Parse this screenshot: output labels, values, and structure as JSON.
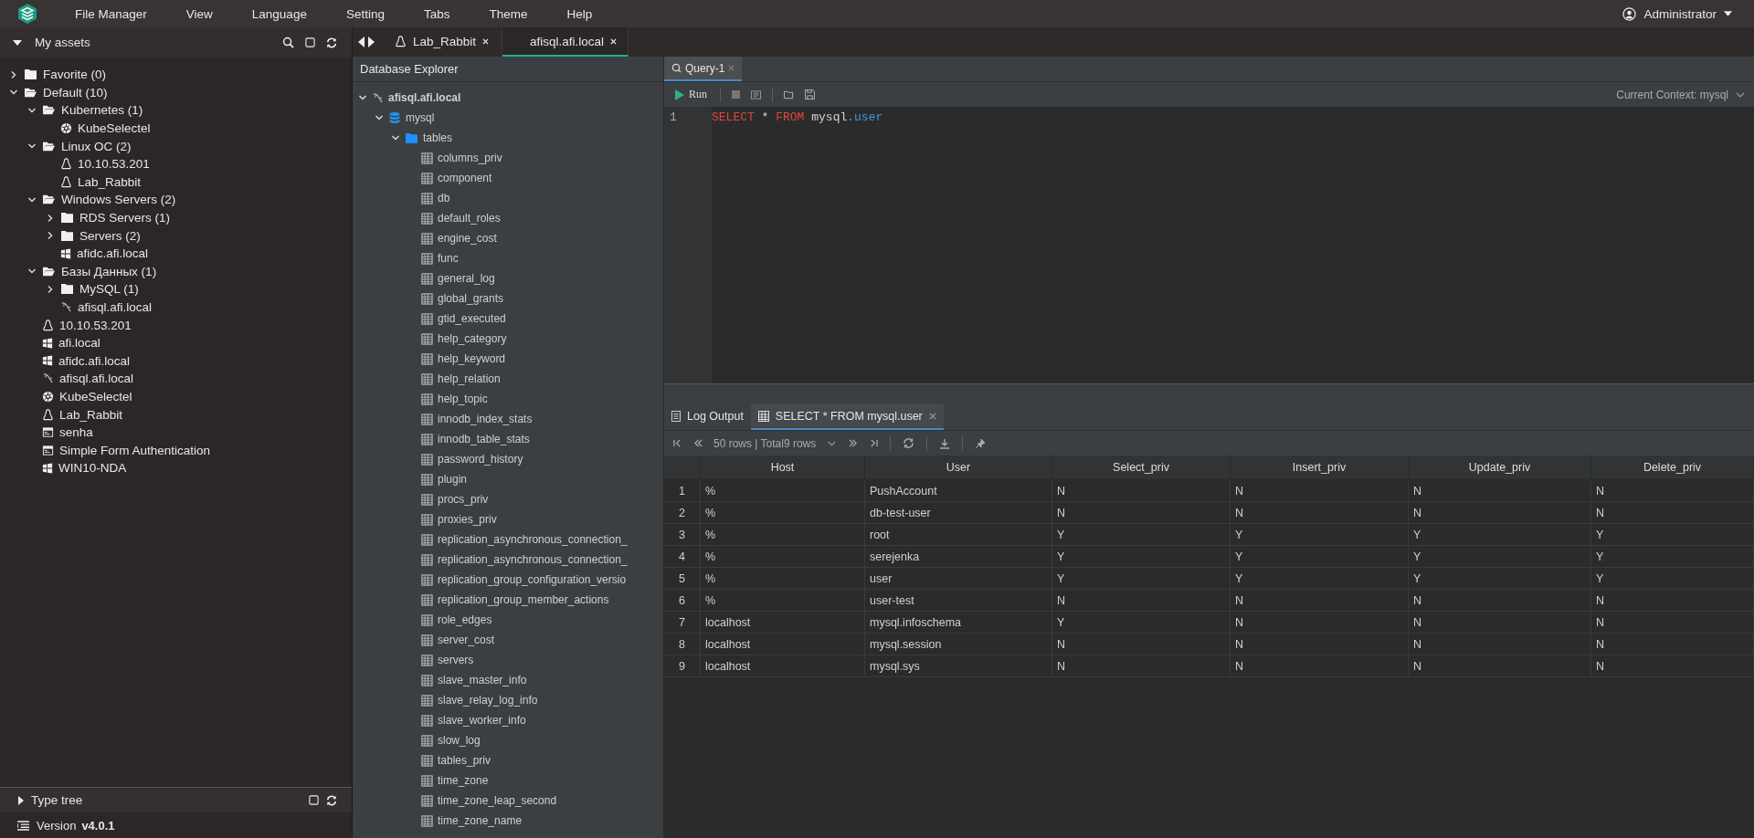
{
  "menu_bar": {
    "items": [
      "File Manager",
      "View",
      "Language",
      "Setting",
      "Tabs",
      "Theme",
      "Help"
    ],
    "user": "Administrator"
  },
  "assets": {
    "title": "My assets",
    "tree": [
      {
        "label": "Favorite (0)",
        "kind": "folder",
        "expanded": false
      },
      {
        "label": "Default (10)",
        "kind": "folder",
        "expanded": true,
        "children": [
          {
            "label": "Kubernetes (1)",
            "kind": "folder",
            "expanded": true,
            "children": [
              {
                "label": "KubeSelectel",
                "kind": "k8s"
              }
            ]
          },
          {
            "label": "Linux OC (2)",
            "kind": "folder",
            "expanded": true,
            "children": [
              {
                "label": "10.10.53.201",
                "kind": "linux"
              },
              {
                "label": "Lab_Rabbit",
                "kind": "linux"
              }
            ]
          },
          {
            "label": "Windows Servers (2)",
            "kind": "folder",
            "expanded": true,
            "children": [
              {
                "label": "RDS Servers (1)",
                "kind": "folder",
                "expanded": false
              },
              {
                "label": "Servers (2)",
                "kind": "folder",
                "expanded": false
              },
              {
                "label": "afidc.afi.local",
                "kind": "windows"
              }
            ]
          },
          {
            "label": "Базы Данных (1)",
            "kind": "folder",
            "expanded": true,
            "children": [
              {
                "label": "MySQL (1)",
                "kind": "folder",
                "expanded": false
              },
              {
                "label": "afisql.afi.local",
                "kind": "mysql"
              }
            ]
          },
          {
            "label": "10.10.53.201",
            "kind": "linux"
          },
          {
            "label": "afi.local",
            "kind": "windows"
          },
          {
            "label": "afidc.afi.local",
            "kind": "windows"
          },
          {
            "label": "afisql.afi.local",
            "kind": "mysql"
          },
          {
            "label": "KubeSelectel",
            "kind": "k8s"
          },
          {
            "label": "Lab_Rabbit",
            "kind": "linux"
          },
          {
            "label": "senha",
            "kind": "web"
          },
          {
            "label": "Simple Form Authentication",
            "kind": "web"
          },
          {
            "label": "WIN10-NDA",
            "kind": "windows"
          }
        ]
      }
    ]
  },
  "type_tree": {
    "label": "Type tree",
    "expanded": false
  },
  "version": {
    "label": "Version",
    "value": "v4.0.1"
  },
  "session_tabs": [
    {
      "label": "Lab_Rabbit",
      "kind": "linux",
      "selected": false
    },
    {
      "label": "afisql.afi.local",
      "kind": "plain",
      "selected": true
    }
  ],
  "explorer": {
    "title": "Database Explorer",
    "tree": [
      {
        "label": "afisql.afi.local",
        "kind": "mysql",
        "expanded": true,
        "children": [
          {
            "label": "mysql",
            "kind": "database",
            "expanded": true,
            "children": [
              {
                "label": "tables",
                "kind": "dbfolder",
                "expanded": true,
                "children": [
                  {
                    "label": "columns_priv",
                    "kind": "table"
                  },
                  {
                    "label": "component",
                    "kind": "table"
                  },
                  {
                    "label": "db",
                    "kind": "table"
                  },
                  {
                    "label": "default_roles",
                    "kind": "table"
                  },
                  {
                    "label": "engine_cost",
                    "kind": "table"
                  },
                  {
                    "label": "func",
                    "kind": "table"
                  },
                  {
                    "label": "general_log",
                    "kind": "table"
                  },
                  {
                    "label": "global_grants",
                    "kind": "table"
                  },
                  {
                    "label": "gtid_executed",
                    "kind": "table"
                  },
                  {
                    "label": "help_category",
                    "kind": "table"
                  },
                  {
                    "label": "help_keyword",
                    "kind": "table"
                  },
                  {
                    "label": "help_relation",
                    "kind": "table"
                  },
                  {
                    "label": "help_topic",
                    "kind": "table"
                  },
                  {
                    "label": "innodb_index_stats",
                    "kind": "table"
                  },
                  {
                    "label": "innodb_table_stats",
                    "kind": "table"
                  },
                  {
                    "label": "password_history",
                    "kind": "table"
                  },
                  {
                    "label": "plugin",
                    "kind": "table"
                  },
                  {
                    "label": "procs_priv",
                    "kind": "table"
                  },
                  {
                    "label": "proxies_priv",
                    "kind": "table"
                  },
                  {
                    "label": "replication_asynchronous_connection_",
                    "kind": "table"
                  },
                  {
                    "label": "replication_asynchronous_connection_",
                    "kind": "table"
                  },
                  {
                    "label": "replication_group_configuration_versio",
                    "kind": "table"
                  },
                  {
                    "label": "replication_group_member_actions",
                    "kind": "table"
                  },
                  {
                    "label": "role_edges",
                    "kind": "table"
                  },
                  {
                    "label": "server_cost",
                    "kind": "table"
                  },
                  {
                    "label": "servers",
                    "kind": "table"
                  },
                  {
                    "label": "slave_master_info",
                    "kind": "table"
                  },
                  {
                    "label": "slave_relay_log_info",
                    "kind": "table"
                  },
                  {
                    "label": "slave_worker_info",
                    "kind": "table"
                  },
                  {
                    "label": "slow_log",
                    "kind": "table"
                  },
                  {
                    "label": "tables_priv",
                    "kind": "table"
                  },
                  {
                    "label": "time_zone",
                    "kind": "table"
                  },
                  {
                    "label": "time_zone_leap_second",
                    "kind": "table"
                  },
                  {
                    "label": "time_zone_name",
                    "kind": "table"
                  }
                ]
              }
            ]
          }
        ]
      }
    ]
  },
  "query_tabs": [
    {
      "label": "Query-1",
      "selected": true
    }
  ],
  "query_toolbar": {
    "run": "Run",
    "context": "Current Context: mysql"
  },
  "editor": {
    "lines": [
      {
        "number": "1",
        "tokens": [
          {
            "text": "SELECT",
            "kind": "keyword"
          },
          {
            "text": " * ",
            "kind": "plain"
          },
          {
            "text": "FROM",
            "kind": "keyword"
          },
          {
            "text": " mysql",
            "kind": "plain"
          },
          {
            "text": ".user",
            "kind": "field"
          }
        ]
      }
    ]
  },
  "result_tabs": [
    {
      "label": "Log Output",
      "kind": "log",
      "selected": false
    },
    {
      "label": "SELECT * FROM mysql.user",
      "kind": "table",
      "selected": true
    }
  ],
  "pager": {
    "summary": "50 rows | Total9 rows"
  },
  "table": {
    "columns": [
      "Host",
      "User",
      "Select_priv",
      "Insert_priv",
      "Update_priv",
      "Delete_priv"
    ],
    "rows": [
      {
        "number": "1",
        "cells": [
          "%",
          "PushAccount",
          "N",
          "N",
          "N",
          "N"
        ]
      },
      {
        "number": "2",
        "cells": [
          "%",
          "db-test-user",
          "N",
          "N",
          "N",
          "N"
        ]
      },
      {
        "number": "3",
        "cells": [
          "%",
          "root",
          "Y",
          "Y",
          "Y",
          "Y"
        ]
      },
      {
        "number": "4",
        "cells": [
          "%",
          "serejenka",
          "Y",
          "Y",
          "Y",
          "Y"
        ]
      },
      {
        "number": "5",
        "cells": [
          "%",
          "user",
          "Y",
          "Y",
          "Y",
          "Y"
        ]
      },
      {
        "number": "6",
        "cells": [
          "%",
          "user-test",
          "N",
          "N",
          "N",
          "N"
        ]
      },
      {
        "number": "7",
        "cells": [
          "localhost",
          "mysql.infoschema",
          "Y",
          "N",
          "N",
          "N"
        ]
      },
      {
        "number": "8",
        "cells": [
          "localhost",
          "mysql.session",
          "N",
          "N",
          "N",
          "N"
        ]
      },
      {
        "number": "9",
        "cells": [
          "localhost",
          "mysql.sys",
          "N",
          "N",
          "N",
          "N"
        ]
      }
    ]
  }
}
